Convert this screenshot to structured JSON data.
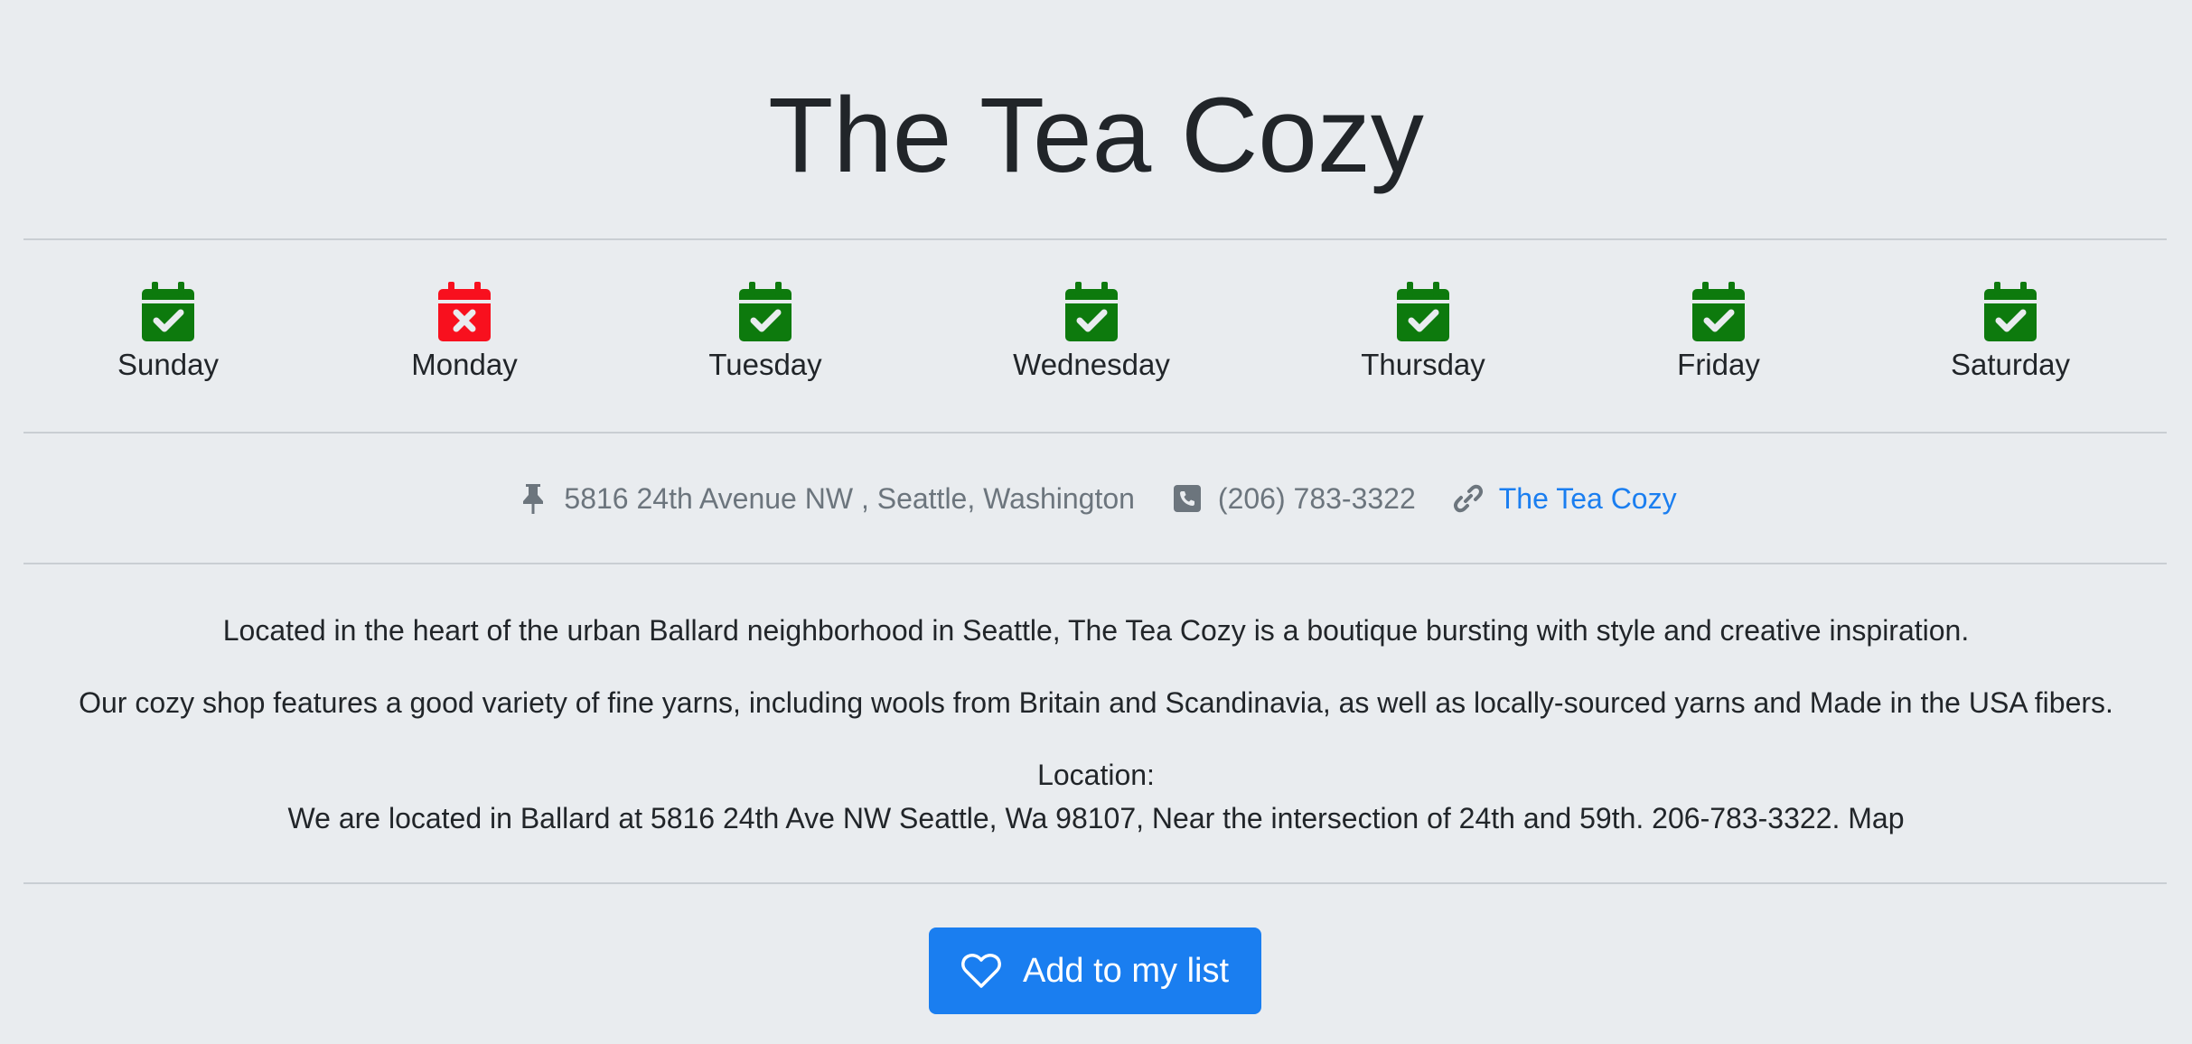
{
  "page": {
    "title": "The Tea Cozy"
  },
  "days": [
    {
      "label": "Sunday",
      "status": "open",
      "icon": "calendar-check-icon",
      "color": "#0d7a0d"
    },
    {
      "label": "Monday",
      "status": "closed",
      "icon": "calendar-x-icon",
      "color": "#f8101e"
    },
    {
      "label": "Tuesday",
      "status": "open",
      "icon": "calendar-check-icon",
      "color": "#0d7a0d"
    },
    {
      "label": "Wednesday",
      "status": "open",
      "icon": "calendar-check-icon",
      "color": "#0d7a0d"
    },
    {
      "label": "Thursday",
      "status": "open",
      "icon": "calendar-check-icon",
      "color": "#0d7a0d"
    },
    {
      "label": "Friday",
      "status": "open",
      "icon": "calendar-check-icon",
      "color": "#0d7a0d"
    },
    {
      "label": "Saturday",
      "status": "open",
      "icon": "calendar-check-icon",
      "color": "#0d7a0d"
    }
  ],
  "contact": {
    "address": "5816 24th Avenue NW , Seattle, Washington",
    "phone": "(206) 783-3322",
    "website_label": "The Tea Cozy",
    "address_icon": "pushpin-icon",
    "phone_icon": "phone-square-icon",
    "website_icon": "link-icon",
    "text_color": "#6c757d",
    "link_color": "#1a7ef0"
  },
  "description": {
    "paragraph_1": "Located in the heart of the urban Ballard neighborhood in Seattle, The Tea Cozy is a boutique bursting with style and creative inspiration.",
    "paragraph_2": "Our cozy shop features a good variety of fine yarns, including wools from Britain and Scandinavia, as well as locally-sourced yarns and Made in the USA fibers.",
    "location_heading": "Location:",
    "location_text": "We are located in Ballard at 5816 24th Ave NW Seattle, Wa 98107, Near the intersection of 24th and 59th. 206-783-3322. Map"
  },
  "actions": {
    "add_to_list_label": "Add to my list",
    "add_to_list_icon": "heart-outline-icon",
    "button_color": "#1a7ef0"
  }
}
